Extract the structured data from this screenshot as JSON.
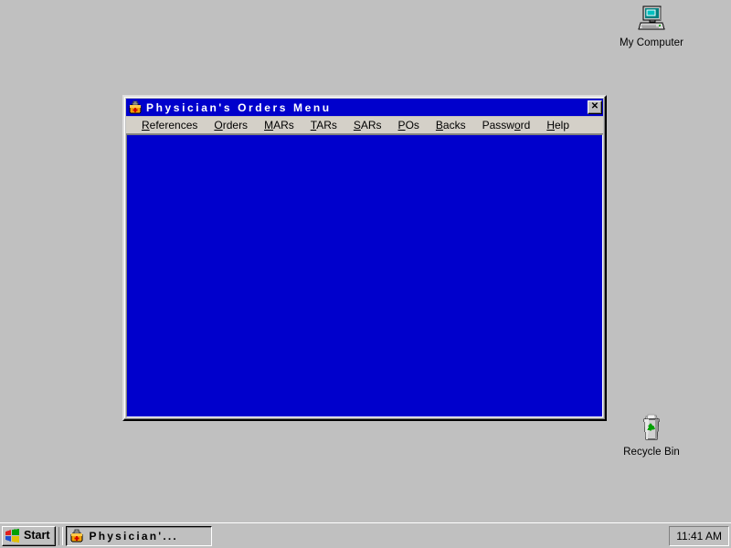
{
  "desktop": {
    "background_color": "#c0c0c0",
    "icons": [
      {
        "name": "my-computer",
        "label": "My Computer",
        "icon": "computer-icon"
      },
      {
        "name": "recycle-bin",
        "label": "Recycle Bin",
        "icon": "recycle-bin-icon"
      }
    ]
  },
  "window": {
    "title": "Physician's Orders Menu",
    "title_icon": "medical-bag-icon",
    "title_bar_color": "#0000cc",
    "client_color": "#0000cc",
    "close_label": "✕",
    "menu": [
      {
        "label": "References",
        "accel": "R",
        "accel_index": 0
      },
      {
        "label": "Orders",
        "accel": "O",
        "accel_index": 0
      },
      {
        "label": "MARs",
        "accel": "M",
        "accel_index": 0
      },
      {
        "label": "TARs",
        "accel": "T",
        "accel_index": 0
      },
      {
        "label": "SARs",
        "accel": "S",
        "accel_index": 0
      },
      {
        "label": "POs",
        "accel": "P",
        "accel_index": 0
      },
      {
        "label": "Backs",
        "accel": "B",
        "accel_index": 0
      },
      {
        "label": "Password",
        "accel": "w",
        "accel_index": 5
      },
      {
        "label": "Help",
        "accel": "H",
        "accel_index": 0
      }
    ]
  },
  "taskbar": {
    "start_label": "Start",
    "start_icon": "windows-flag-icon",
    "tasks": [
      {
        "label": "Physician'...",
        "icon": "medical-bag-icon",
        "active": true
      }
    ],
    "clock": "11:41 AM"
  }
}
